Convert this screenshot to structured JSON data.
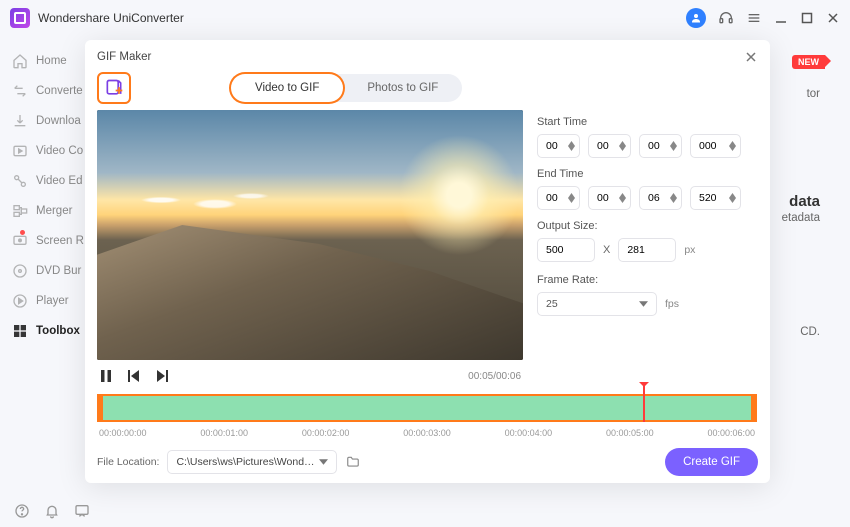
{
  "app": {
    "title": "Wondershare UniConverter"
  },
  "sidebar": {
    "items": [
      {
        "label": "Home"
      },
      {
        "label": "Converte"
      },
      {
        "label": "Downloa"
      },
      {
        "label": "Video Co"
      },
      {
        "label": "Video Ed"
      },
      {
        "label": "Merger"
      },
      {
        "label": "Screen R"
      },
      {
        "label": "DVD Bur"
      },
      {
        "label": "Player"
      },
      {
        "label": "Toolbox"
      }
    ]
  },
  "bg": {
    "new": "NEW",
    "tor": "tor",
    "data": "data",
    "etadata": "etadata",
    "cd": "CD."
  },
  "modal": {
    "title": "GIF Maker",
    "tabs": {
      "video": "Video to GIF",
      "photos": "Photos to GIF"
    },
    "time_now": "00:05/00:06",
    "start_label": "Start Time",
    "end_label": "End Time",
    "start": {
      "h": "00",
      "m": "00",
      "s": "00",
      "ms": "000"
    },
    "end": {
      "h": "00",
      "m": "00",
      "s": "06",
      "ms": "520"
    },
    "output_label": "Output Size:",
    "output": {
      "w": "500",
      "h": "281",
      "x": "X",
      "unit": "px"
    },
    "framerate_label": "Frame Rate:",
    "framerate": "25",
    "fps": "fps",
    "ticks": [
      "00:00:00:00",
      "00:00:01:00",
      "00:00:02:00",
      "00:00:03:00",
      "00:00:04:00",
      "00:00:05:00",
      "00:00:06:00"
    ],
    "playhead_pct": 83,
    "file_location_label": "File Location:",
    "file_location_value": "C:\\Users\\ws\\Pictures\\Wonders",
    "create": "Create GIF"
  }
}
